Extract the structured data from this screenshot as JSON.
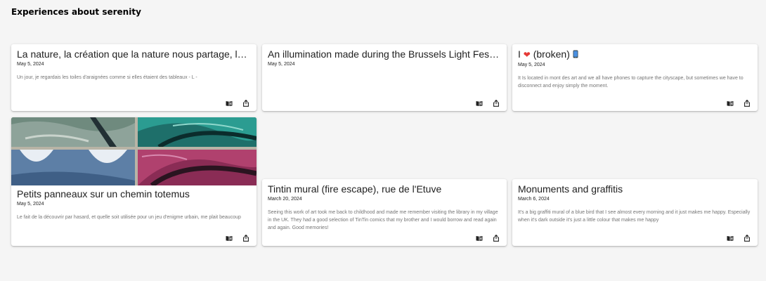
{
  "page": {
    "title": "Experiences about serenity"
  },
  "cards": [
    {
      "title": "La nature, la création que la nature nous partage, les arbres, les fleurs...",
      "date": "May 5, 2024",
      "description": "Un jour, je regardais les toiles d'araignées comme si elles étaient des tableaux - L -"
    },
    {
      "title": "An illumination made during the Brussels Light Festival about serenity",
      "date": "May 5, 2024",
      "description": ""
    },
    {
      "title_prefix": "I",
      "title_suffix": "(broken)",
      "date": "May 5, 2024",
      "description": "It Is located in mont des art and we all have phones to capture the cityscape, but sometimes we have to disconnect and enjoy simply the moment."
    },
    {
      "title": "Petits panneaux sur un chemin totemus",
      "date": "May 5, 2024",
      "description": "Le fait de la découvrir par hasard, et quelle soit utilisée pour un jeu d'enigme urbain, me plait beaucoup"
    },
    {
      "title": "Tintin mural (fire escape), rue de l'Etuve",
      "date": "March 20, 2024",
      "description": "Seeing this work of art took me back to childhood and made me remember visiting the library in my village in the UK. They had a good selection of TinTin comics that my brother and I would borrow and read again and again. Good memories!"
    },
    {
      "title": "Monuments and graffitis",
      "date": "March 6, 2024",
      "description": "It's a big graffiti mural of a blue bird that I see almost every morning and it just makes me happy. Especially when it's dark outside it's just a little colour that makes me happy"
    }
  ],
  "icons": {
    "read": "book-icon",
    "share": "share-icon",
    "heart": "heart-icon",
    "phone": "phone-icon"
  },
  "colors": {
    "background": "#f5f5f5",
    "card": "#ffffff",
    "heart": "#e53935",
    "phone": "#4a90e2"
  }
}
